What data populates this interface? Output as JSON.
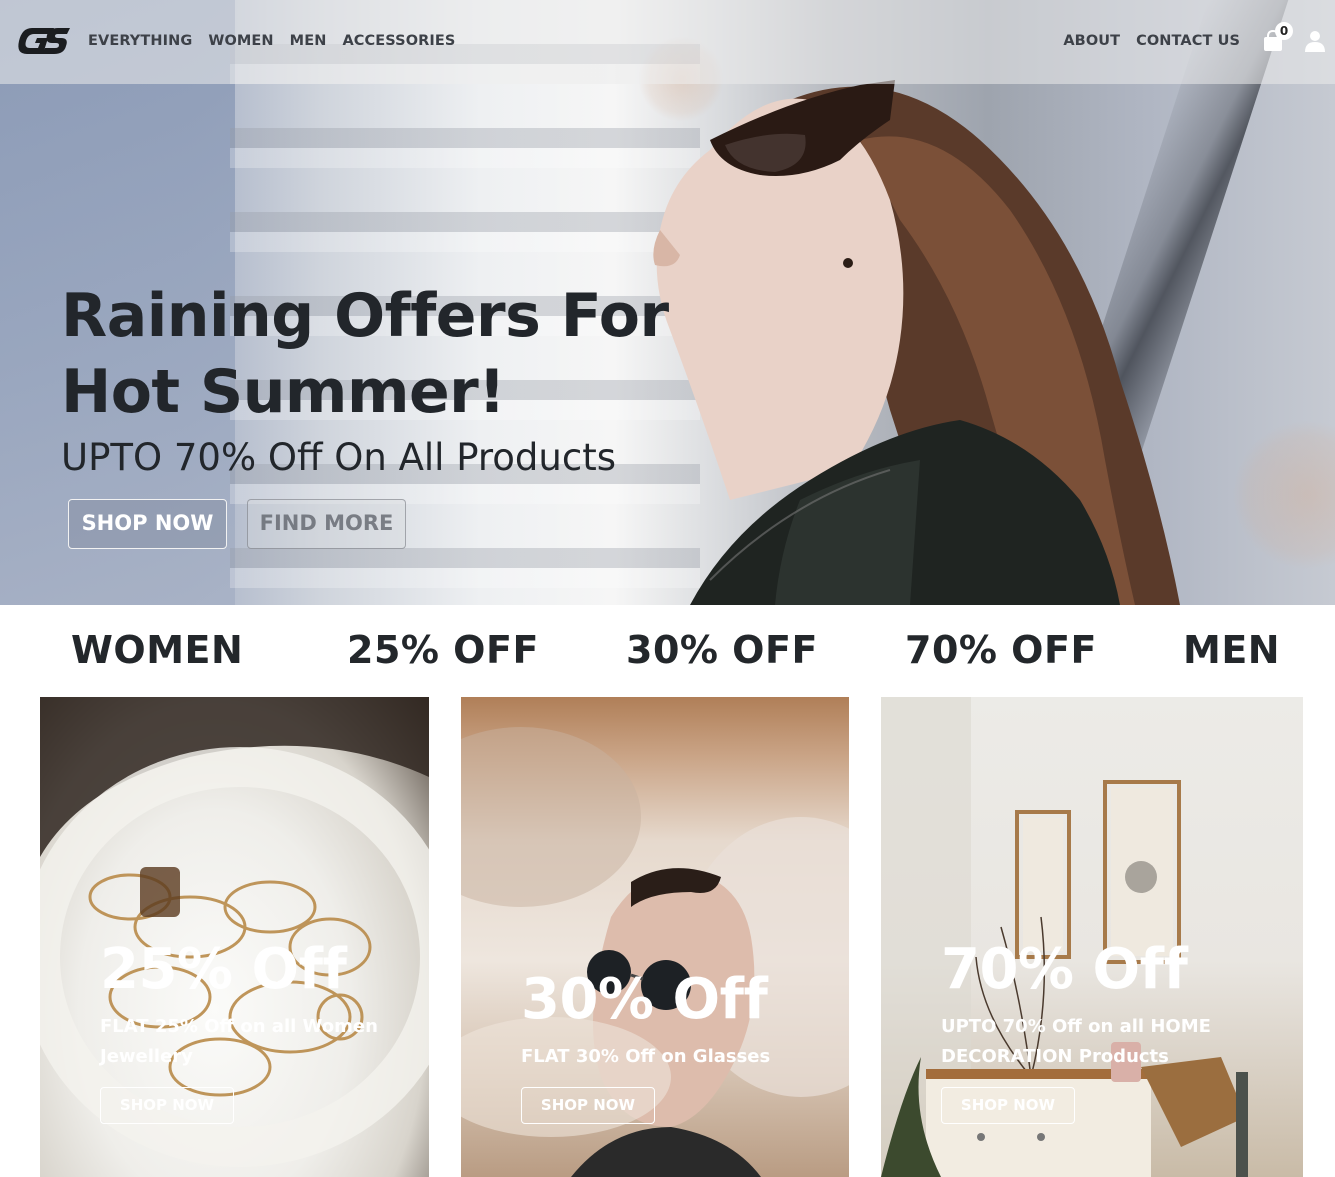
{
  "brand": {
    "logo_text": "GS"
  },
  "nav": {
    "left": [
      "EVERYTHING",
      "WOMEN",
      "MEN",
      "ACCESSORIES"
    ],
    "right": [
      "ABOUT",
      "CONTACT US"
    ],
    "cart_count": "0"
  },
  "hero": {
    "title": "Raining Offers For Hot Summer!",
    "subtitle": "UPTO 70% Off On All Products",
    "shop_button": "SHOP NOW",
    "find_button": "FIND MORE"
  },
  "categories": [
    "WOMEN",
    "25% OFF",
    "30% OFF",
    "70% OFF",
    "MEN"
  ],
  "cards": [
    {
      "title": "25% Off",
      "text": "FLAT 25% Off on all Women Jewellery",
      "button": "SHOP NOW"
    },
    {
      "title": "30% Off",
      "text": "FLAT 30% Off on Glasses",
      "button": "SHOP NOW"
    },
    {
      "title": "70% Off",
      "text": "UPTO 70% Off on all HOME DECORATION Products",
      "button": "SHOP NOW"
    }
  ],
  "icons": {
    "cart": "shopping-bag-icon",
    "user": "user-icon"
  },
  "colors": {
    "text_dark": "#23272b",
    "white": "#ffffff"
  }
}
